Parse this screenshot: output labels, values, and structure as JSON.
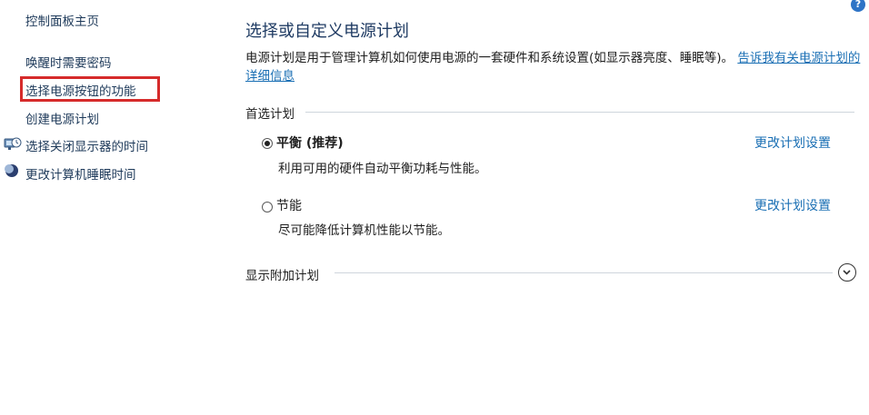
{
  "sidebar": {
    "home": "控制面板主页",
    "items": [
      {
        "label": "唤醒时需要密码"
      },
      {
        "label": "选择电源按钮的功能"
      },
      {
        "label": "创建电源计划"
      },
      {
        "label": "选择关闭显示器的时间",
        "icon": "monitor-clock-icon"
      },
      {
        "label": "更改计算机睡眠时间",
        "icon": "moon-icon"
      }
    ]
  },
  "help": {
    "glyph": "?",
    "icon": "help-icon"
  },
  "main": {
    "title": "选择或自定义电源计划",
    "description": "电源计划是用于管理计算机如何使用电源的一套硬件和系统设置(如显示器亮度、睡眠等)。",
    "description_link": "告诉我有关电源计划的详细信息",
    "preferred_header": "首选计划",
    "plans": [
      {
        "name": "平衡 (推荐)",
        "desc": "利用可用的硬件自动平衡功耗与性能。",
        "selected": true,
        "change_label": "更改计划设置"
      },
      {
        "name": "节能",
        "desc": "尽可能降低计算机性能以节能。",
        "selected": false,
        "change_label": "更改计划设置"
      }
    ],
    "additional_header": "显示附加计划"
  },
  "colors": {
    "highlight": "#d62b2b",
    "link": "#1a6fb4",
    "title": "#1f3b63"
  }
}
